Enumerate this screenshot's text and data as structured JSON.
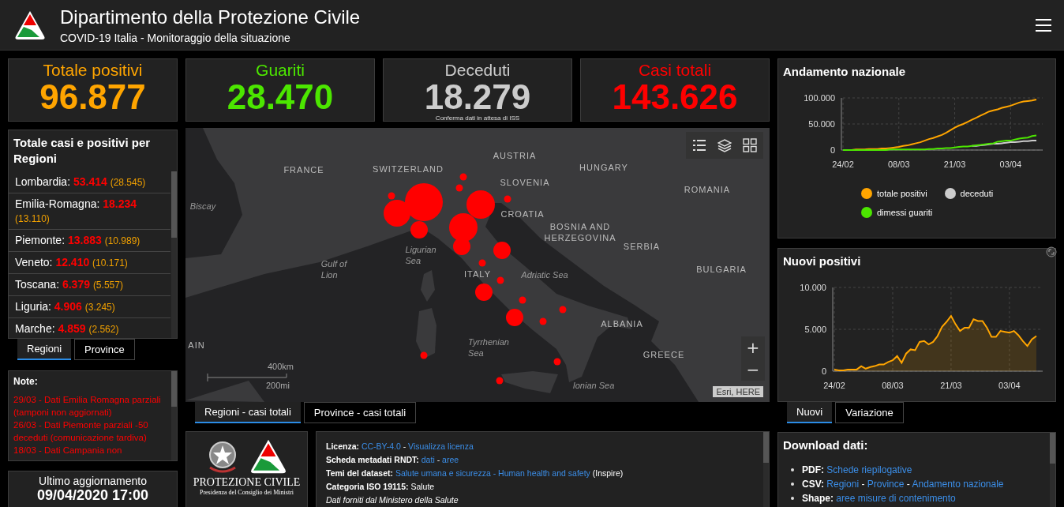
{
  "header": {
    "title": "Dipartimento della Protezione Civile",
    "subtitle": "COVID-19 Italia - Monitoraggio della situazione"
  },
  "stats": [
    {
      "label": "Totale positivi",
      "value": "96.877",
      "color": "#ffa500"
    },
    {
      "label": "Guariti",
      "value": "28.470",
      "color": "#4ce600"
    },
    {
      "label": "Deceduti",
      "value": "18.279",
      "note": "Conferma dati in attesa di ISS",
      "color": "#cccccc"
    },
    {
      "label": "Casi totali",
      "value": "143.626",
      "color": "#ff0000"
    }
  ],
  "regions_panel": {
    "title": "Totale casi e positivi per Regioni",
    "items": [
      {
        "name": "Lombardia:",
        "total": "53.414",
        "positive": "(28.545)"
      },
      {
        "name": "Emilia-Romagna:",
        "total": "18.234",
        "positive": "(13.110)"
      },
      {
        "name": "Piemonte:",
        "total": "13.883",
        "positive": "(10.989)"
      },
      {
        "name": "Veneto:",
        "total": "12.410",
        "positive": "(10.171)"
      },
      {
        "name": "Toscana:",
        "total": "6.379",
        "positive": "(5.557)"
      },
      {
        "name": "Liguria:",
        "total": "4.906",
        "positive": "(3.245)"
      },
      {
        "name": "Marche:",
        "total": "4.859",
        "positive": "(2.562)"
      }
    ]
  },
  "region_tabs": [
    {
      "label": "Regioni",
      "selected": true
    },
    {
      "label": "Province",
      "selected": false
    }
  ],
  "notes_panel": {
    "title": "Note:",
    "items": [
      "29/03 - Dati  Emilia Romagna parziali (tamponi non aggiornati)",
      "26/03 - Dati Piemonte parziali -50 deceduti (comunicazione tardiva)",
      "18/03 - Dati Campania non"
    ]
  },
  "last_update": {
    "label": "Ultimo aggiornamento",
    "value": "09/04/2020 17:00"
  },
  "map": {
    "labels": [
      {
        "text": "FRANCE",
        "kind": "country"
      },
      {
        "text": "SWITZERLAND",
        "kind": "country"
      },
      {
        "text": "AUSTRIA",
        "kind": "country"
      },
      {
        "text": "HUNGARY",
        "kind": "country"
      },
      {
        "text": "SLOVENIA",
        "kind": "country"
      },
      {
        "text": "ROMANIA",
        "kind": "country"
      },
      {
        "text": "Biscay",
        "kind": "sea"
      },
      {
        "text": "CROATIA",
        "kind": "country"
      },
      {
        "text": "BOSNIA AND\nHERZEGOVINA",
        "kind": "country"
      },
      {
        "text": "SERBIA",
        "kind": "country"
      },
      {
        "text": "Ligurian\nSea",
        "kind": "sea"
      },
      {
        "text": "Gulf of\nLion",
        "kind": "sea"
      },
      {
        "text": "ITALY",
        "kind": "country"
      },
      {
        "text": "Adriatic Sea",
        "kind": "sea"
      },
      {
        "text": "BULGARIA",
        "kind": "country"
      },
      {
        "text": "ALBANIA",
        "kind": "country"
      },
      {
        "text": "AIN",
        "kind": "country"
      },
      {
        "text": "Tyrrhenian\nSea",
        "kind": "sea"
      },
      {
        "text": "GREECE",
        "kind": "country"
      },
      {
        "text": "Ionian Sea",
        "kind": "sea"
      }
    ],
    "zoom_in": "+",
    "zoom_out": "−",
    "scale_km": "400km",
    "scale_mi": "200mi",
    "attribution": "Esri, HERE"
  },
  "map_tabs": [
    {
      "label": "Regioni - casi totali",
      "selected": true
    },
    {
      "label": "Province - casi totali",
      "selected": false
    }
  ],
  "credits_panel": {
    "name": "PROTEZIONE CIVILE",
    "subtitle": "Presidenza del Consiglio dei Ministri"
  },
  "metadata_panel": {
    "lines": [
      {
        "kind": "field",
        "label": "Licenza:",
        "parts": [
          {
            "text": "CC-BY-4.0",
            "kind": "link"
          },
          {
            "text": "-",
            "kind": "text"
          },
          {
            "text": "Visualizza licenza",
            "kind": "link"
          }
        ]
      },
      {
        "kind": "field",
        "label": "Scheda metadati RNDT:",
        "parts": [
          {
            "text": "dati",
            "kind": "link"
          },
          {
            "text": "-",
            "kind": "text"
          },
          {
            "text": "aree",
            "kind": "link"
          }
        ]
      },
      {
        "kind": "field",
        "label": "Temi del dataset:",
        "parts": [
          {
            "text": "Salute umana e sicurezza - Human health and safety",
            "kind": "link"
          },
          {
            "text": "(Inspire)",
            "kind": "text"
          }
        ]
      },
      {
        "kind": "field",
        "label": "Categoria ISO 19115:",
        "parts": [
          {
            "text": "Salute",
            "kind": "text"
          }
        ]
      },
      {
        "kind": "italic",
        "label": "Dati forniti dal Ministero della Salute"
      }
    ]
  },
  "andamento_panel": {
    "title": "Andamento nazionale",
    "chart_data": {
      "type": "line",
      "categories": [
        "24/02",
        null,
        null,
        null,
        null,
        null,
        null,
        null,
        null,
        null,
        null,
        null,
        null,
        "08/03",
        null,
        null,
        null,
        null,
        null,
        null,
        null,
        null,
        null,
        null,
        null,
        null,
        "21/03",
        null,
        null,
        null,
        null,
        null,
        null,
        null,
        null,
        null,
        null,
        null,
        null,
        "03/04",
        null,
        null,
        null,
        null,
        null,
        null
      ],
      "ylim": [
        0,
        100
      ],
      "grid": true,
      "yticks": [
        {
          "value": 0,
          "label": "0"
        },
        {
          "value": 50,
          "label": "50.000"
        },
        {
          "value": 100,
          "label": "100.000"
        }
      ],
      "series": [
        {
          "name": "totale positivi",
          "color": "#ffa500",
          "values": [
            0,
            0,
            0,
            1,
            1,
            1,
            2,
            2,
            2,
            3,
            3,
            4,
            5,
            6,
            8,
            9,
            11,
            13,
            15,
            18,
            21,
            23,
            26,
            29,
            33,
            38,
            43,
            47,
            50,
            54,
            58,
            62,
            66,
            70,
            74,
            76,
            78,
            81,
            83,
            85,
            88,
            91,
            93,
            94,
            95,
            97
          ]
        },
        {
          "name": "deceduti",
          "color": "#cccccc",
          "values": [
            null,
            null,
            null,
            null,
            null,
            null,
            null,
            null,
            null,
            null,
            null,
            null,
            null,
            null,
            null,
            null,
            null,
            null,
            null,
            null,
            null,
            null,
            null,
            null,
            null,
            null,
            null,
            null,
            null,
            null,
            8,
            8,
            9,
            10,
            11,
            12,
            12,
            13,
            14,
            15,
            15,
            16,
            17,
            17,
            18,
            18
          ]
        },
        {
          "name": "dimessi guariti",
          "color": "#4ce600",
          "values": [
            0,
            0,
            0,
            0,
            0,
            0,
            0,
            0,
            0,
            0,
            0,
            1,
            1,
            1,
            1,
            1,
            1,
            1,
            1,
            1,
            2,
            2,
            3,
            3,
            4,
            4,
            5,
            6,
            7,
            7,
            8,
            9,
            10,
            11,
            12,
            13,
            16,
            17,
            18,
            18,
            20,
            22,
            23,
            24,
            27,
            28
          ]
        }
      ]
    }
  },
  "nuovi_panel": {
    "title": "Nuovi positivi",
    "chart_data": {
      "type": "area",
      "categories": [
        "24/02",
        null,
        null,
        null,
        null,
        null,
        null,
        null,
        null,
        null,
        null,
        null,
        null,
        "08/03",
        null,
        null,
        null,
        null,
        null,
        null,
        null,
        null,
        null,
        null,
        null,
        null,
        "21/03",
        null,
        null,
        null,
        null,
        null,
        null,
        null,
        null,
        null,
        null,
        null,
        null,
        "03/04",
        null,
        null,
        null,
        null,
        null,
        null
      ],
      "ylim": [
        0,
        10
      ],
      "grid": true,
      "yticks": [
        {
          "value": 0,
          "label": "0"
        },
        {
          "value": 5,
          "label": "5.000"
        },
        {
          "value": 10,
          "label": "10.000"
        }
      ],
      "series": [
        {
          "color": "#ffa500",
          "values": [
            0.2,
            0.1,
            0.1,
            0.2,
            0.2,
            0.2,
            0.6,
            0.3,
            0.5,
            0.6,
            0.8,
            0.8,
            1.1,
            1.3,
            1.8,
            1.0,
            2.1,
            2.6,
            2.5,
            3.5,
            3.6,
            3.2,
            3.5,
            4.2,
            5.3,
            5.9,
            6.6,
            5.6,
            4.8,
            5.2,
            5.2,
            6.2,
            6.0,
            6.0,
            5.2,
            4.1,
            4.1,
            4.8,
            4.7,
            4.6,
            4.8,
            4.3,
            3.6,
            3.0,
            3.8,
            4.2
          ]
        }
      ]
    }
  },
  "chart_tabs": [
    {
      "label": "Nuovi",
      "selected": true
    },
    {
      "label": "Variazione",
      "selected": false
    }
  ],
  "download_panel": {
    "title": "Download dati:",
    "items": [
      {
        "label": "PDF:",
        "parts": [
          {
            "text": "Schede riepilogative",
            "kind": "link"
          }
        ]
      },
      {
        "label": "CSV:",
        "parts": [
          {
            "text": "Regioni",
            "kind": "link"
          },
          {
            "text": "-",
            "kind": "text"
          },
          {
            "text": "Province",
            "kind": "link"
          },
          {
            "text": "-",
            "kind": "text"
          },
          {
            "text": "Andamento nazionale",
            "kind": "link"
          }
        ]
      },
      {
        "label": "Shape:",
        "parts": [
          {
            "text": "aree misure di contenimento",
            "kind": "link"
          }
        ]
      }
    ]
  }
}
